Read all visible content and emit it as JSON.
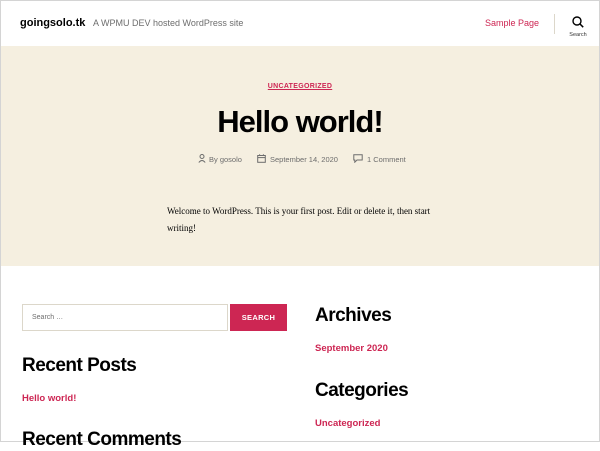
{
  "header": {
    "site_title": "goingsolo.tk",
    "site_description": "A WPMU DEV hosted WordPress site",
    "nav": [
      "Sample Page"
    ],
    "search_label": "Search"
  },
  "post": {
    "category": "UNCATEGORIZED",
    "title": "Hello world!",
    "author": "By gosolo",
    "date": "September 14, 2020",
    "comments": "1 Comment",
    "body": "Welcome to WordPress. This is your first post. Edit or delete it, then start writing!"
  },
  "widgets": {
    "search_placeholder": "Search …",
    "search_button": "SEARCH",
    "recent_posts_title": "Recent Posts",
    "recent_posts": [
      "Hello world!"
    ],
    "recent_comments_title": "Recent Comments",
    "archives_title": "Archives",
    "archives": [
      "September 2020"
    ],
    "categories_title": "Categories",
    "categories": [
      "Uncategorized"
    ]
  },
  "colors": {
    "accent": "#cd2653",
    "hero_background": "#f5efe0",
    "secondary_text": "#6d6d6d"
  }
}
